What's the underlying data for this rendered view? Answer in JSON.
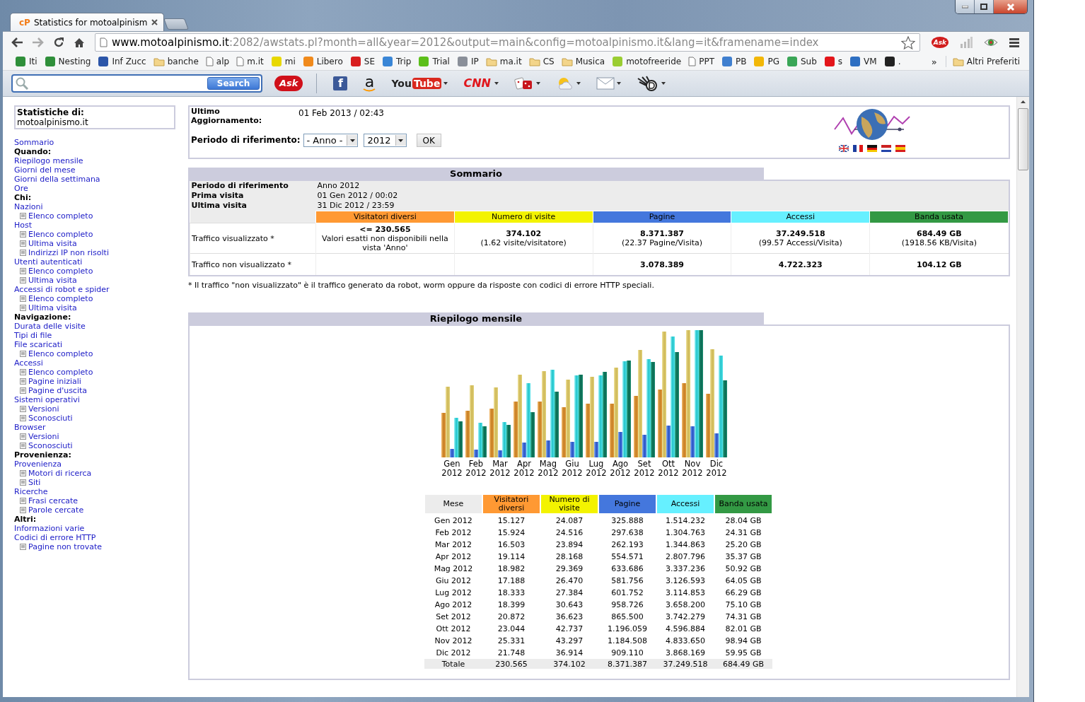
{
  "window": {
    "tab_icon_text": "cP",
    "tab_title": "Statistics for motoalpinism",
    "url_host": "www.motoalpinismo.it",
    "url_path": ":2082/awstats.pl?month=all&year=2012&output=main&config=motoalpinismo.it&lang=it&framename=index",
    "extension_label": "Ask"
  },
  "bookmarks": [
    {
      "label": "Iti",
      "kind": "site",
      "color": "#2f8f3a"
    },
    {
      "label": "Nesting",
      "kind": "site",
      "color": "#2f8f3a"
    },
    {
      "label": "Inf Zucc",
      "kind": "site",
      "color": "#2b55a8"
    },
    {
      "label": "banche",
      "kind": "folder"
    },
    {
      "label": "alp",
      "kind": "page"
    },
    {
      "label": "m.it",
      "kind": "page"
    },
    {
      "label": "mi",
      "kind": "site",
      "color": "#e8d800"
    },
    {
      "label": "Libero",
      "kind": "site",
      "color": "#f08a1c"
    },
    {
      "label": "SE",
      "kind": "site",
      "color": "#d81e1e"
    },
    {
      "label": "Trip",
      "kind": "site",
      "color": "#3a86d6"
    },
    {
      "label": "Trial",
      "kind": "site",
      "color": "#5cbf1a"
    },
    {
      "label": "IP",
      "kind": "site",
      "color": "#8a8f99"
    },
    {
      "label": "ma.it",
      "kind": "folder"
    },
    {
      "label": "CS",
      "kind": "folder"
    },
    {
      "label": "Musica",
      "kind": "folder"
    },
    {
      "label": "motofreeride",
      "kind": "site",
      "color": "#9acd32"
    },
    {
      "label": "PPT",
      "kind": "page"
    },
    {
      "label": "PB",
      "kind": "site",
      "color": "#3f7fcf"
    },
    {
      "label": "PG",
      "kind": "site",
      "color": "#f2b707"
    },
    {
      "label": "Sub",
      "kind": "site",
      "color": "#3aa657"
    },
    {
      "label": "s",
      "kind": "site",
      "color": "#e3151a"
    },
    {
      "label": "VM",
      "kind": "site",
      "color": "#2e6fc2"
    },
    {
      "label": ".",
      "kind": "site",
      "color": "#222222"
    }
  ],
  "bookmarks_overflow": "»",
  "other_bookmarks": "Altri Preferiti",
  "ask_toolbar": {
    "search_button": "Search",
    "items": [
      {
        "kind": "ask",
        "label": "Ask",
        "dropdown": false
      },
      {
        "kind": "facebook",
        "label": "f",
        "dropdown": false
      },
      {
        "kind": "amazon",
        "label": "a",
        "dropdown": false
      },
      {
        "kind": "youtube",
        "label": "You",
        "label_2": "Tube",
        "dropdown": true
      },
      {
        "kind": "cnn",
        "label": "CNN",
        "dropdown": true
      },
      {
        "kind": "dice",
        "dropdown": true
      },
      {
        "kind": "weather",
        "dropdown": true
      },
      {
        "kind": "mail",
        "dropdown": true
      },
      {
        "kind": "hand",
        "dropdown": true
      }
    ]
  },
  "sidebar": {
    "title": "Statistiche di:",
    "site": "motoalpinismo.it",
    "items": [
      {
        "kind": "link",
        "label": "Sommario"
      },
      {
        "kind": "heading",
        "label": "Quando:"
      },
      {
        "kind": "link",
        "label": "Riepilogo mensile"
      },
      {
        "kind": "link",
        "label": "Giorni del mese"
      },
      {
        "kind": "link",
        "label": "Giorni della settimana"
      },
      {
        "kind": "link",
        "label": "Ore"
      },
      {
        "kind": "heading",
        "label": "Chi:"
      },
      {
        "kind": "link",
        "label": "Nazioni",
        "children": [
          {
            "label": "Elenco completo"
          }
        ]
      },
      {
        "kind": "link",
        "label": "Host",
        "children": [
          {
            "label": "Elenco completo"
          },
          {
            "label": "Ultima visita"
          },
          {
            "label": "Indirizzi IP non risolti"
          }
        ]
      },
      {
        "kind": "link",
        "label": "Utenti autenticati",
        "children": [
          {
            "label": "Elenco completo"
          },
          {
            "label": "Ultima visita"
          }
        ]
      },
      {
        "kind": "link",
        "label": "Accessi di robot e spider",
        "children": [
          {
            "label": "Elenco completo"
          },
          {
            "label": "Ultima visita"
          }
        ]
      },
      {
        "kind": "heading",
        "label": "Navigazione:"
      },
      {
        "kind": "link",
        "label": "Durata delle visite"
      },
      {
        "kind": "link",
        "label": "Tipi di file"
      },
      {
        "kind": "link",
        "label": "File scaricati",
        "children": [
          {
            "label": "Elenco completo"
          }
        ]
      },
      {
        "kind": "link",
        "label": "Accessi",
        "children": [
          {
            "label": "Elenco completo"
          },
          {
            "label": "Pagine iniziali"
          },
          {
            "label": "Pagine d'uscita"
          }
        ]
      },
      {
        "kind": "link",
        "label": "Sistemi operativi",
        "children": [
          {
            "label": "Versioni"
          },
          {
            "label": "Sconosciuti"
          }
        ]
      },
      {
        "kind": "link",
        "label": "Browser",
        "children": [
          {
            "label": "Versioni"
          },
          {
            "label": "Sconosciuti"
          }
        ]
      },
      {
        "kind": "heading",
        "label": "Provenienza:"
      },
      {
        "kind": "link",
        "label": "Provenienza",
        "children": [
          {
            "label": "Motori di ricerca"
          },
          {
            "label": "Siti"
          }
        ]
      },
      {
        "kind": "link",
        "label": "Ricerche",
        "children": [
          {
            "label": "Frasi cercate"
          },
          {
            "label": "Parole cercate"
          }
        ]
      },
      {
        "kind": "heading",
        "label": "Altri:"
      },
      {
        "kind": "link",
        "label": "Informazioni varie"
      },
      {
        "kind": "link",
        "label": "Codici di errore HTTP",
        "children": [
          {
            "label": "Pagine non trovate"
          }
        ]
      }
    ]
  },
  "update": {
    "label": "Ultimo Aggiornamento:",
    "value": "01 Feb 2013 / 02:43"
  },
  "period": {
    "label": "Periodo di riferimento:",
    "month": "- Anno -",
    "year": "2012",
    "button": "OK"
  },
  "summary": {
    "title": "Sommario",
    "info": [
      {
        "label": "Periodo di riferimento",
        "value": "Anno 2012"
      },
      {
        "label": "Prima visita",
        "value": "01 Gen 2012 / 00:02"
      },
      {
        "label": "Ultima visita",
        "value": "31 Dic 2012 / 23:59"
      }
    ],
    "columns": [
      {
        "label": "Visitatori diversi",
        "color": "#ff9933"
      },
      {
        "label": "Numero di visite",
        "color": "#f3f300"
      },
      {
        "label": "Pagine",
        "color": "#4477dd"
      },
      {
        "label": "Accessi",
        "color": "#66f0ff"
      },
      {
        "label": "Banda usata",
        "color": "#339944"
      }
    ],
    "rows": [
      {
        "label": "Traffico visualizzato *",
        "cells": [
          {
            "main": "<= 230.565",
            "sub": "Valori esatti non disponibili nella vista 'Anno'"
          },
          {
            "main": "374.102",
            "sub": "(1.62 visite/visitatore)"
          },
          {
            "main": "8.371.387",
            "sub": "(22.37 Pagine/Visita)"
          },
          {
            "main": "37.249.518",
            "sub": "(99.57 Accessi/Visita)"
          },
          {
            "main": "684.49 GB",
            "sub": "(1918.56 KB/Visita)"
          }
        ]
      },
      {
        "label": "Traffico non visualizzato *",
        "cells": [
          null,
          null,
          {
            "main": "3.078.389"
          },
          {
            "main": "4.722.323"
          },
          {
            "main": "104.12 GB"
          }
        ]
      }
    ],
    "footnote": "* Il traffico \"non visualizzato\" è il traffico generato da robot, worm oppure da risposte con codici di errore HTTP speciali."
  },
  "monthly": {
    "title": "Riepilogo mensile",
    "chart_labels": [
      {
        "month": "Gen",
        "year": "2012"
      },
      {
        "month": "Feb",
        "year": "2012"
      },
      {
        "month": "Mar",
        "year": "2012"
      },
      {
        "month": "Apr",
        "year": "2012"
      },
      {
        "month": "Mag",
        "year": "2012"
      },
      {
        "month": "Giu",
        "year": "2012"
      },
      {
        "month": "Lug",
        "year": "2012"
      },
      {
        "month": "Ago",
        "year": "2012"
      },
      {
        "month": "Set",
        "year": "2012"
      },
      {
        "month": "Ott",
        "year": "2012"
      },
      {
        "month": "Nov",
        "year": "2012"
      },
      {
        "month": "Dic",
        "year": "2012"
      }
    ],
    "columns": [
      {
        "label": "Mese"
      },
      {
        "label": "Visitatori diversi",
        "color": "#ff9933"
      },
      {
        "label": "Numero di visite",
        "color": "#f3f300"
      },
      {
        "label": "Pagine",
        "color": "#4477dd"
      },
      {
        "label": "Accessi",
        "color": "#66f0ff"
      },
      {
        "label": "Banda usata",
        "color": "#339944"
      }
    ],
    "rows": [
      [
        "Gen 2012",
        "15.127",
        "24.087",
        "325.888",
        "1.514.232",
        "28.04 GB"
      ],
      [
        "Feb 2012",
        "15.924",
        "24.516",
        "297.638",
        "1.304.763",
        "24.31 GB"
      ],
      [
        "Mar 2012",
        "16.503",
        "23.894",
        "262.193",
        "1.344.863",
        "25.20 GB"
      ],
      [
        "Apr 2012",
        "19.114",
        "28.168",
        "554.571",
        "2.807.796",
        "35.37 GB"
      ],
      [
        "Mag 2012",
        "18.982",
        "29.369",
        "633.686",
        "3.337.236",
        "50.92 GB"
      ],
      [
        "Giu 2012",
        "17.188",
        "26.470",
        "581.756",
        "3.126.593",
        "64.05 GB"
      ],
      [
        "Lug 2012",
        "18.333",
        "27.384",
        "601.752",
        "3.114.853",
        "66.29 GB"
      ],
      [
        "Ago 2012",
        "18.399",
        "30.643",
        "958.726",
        "3.658.200",
        "75.10 GB"
      ],
      [
        "Set 2012",
        "20.872",
        "36.623",
        "865.500",
        "3.742.279",
        "74.31 GB"
      ],
      [
        "Ott 2012",
        "23.044",
        "42.737",
        "1.196.059",
        "4.596.884",
        "82.01 GB"
      ],
      [
        "Nov 2012",
        "25.331",
        "43.297",
        "1.184.508",
        "4.833.650",
        "98.94 GB"
      ],
      [
        "Dic 2012",
        "21.748",
        "36.914",
        "909.110",
        "3.868.169",
        "59.95 GB"
      ]
    ],
    "total": [
      "Totale",
      "230.565",
      "374.102",
      "8.371.387",
      "37.249.518",
      "684.49 GB"
    ]
  }
}
